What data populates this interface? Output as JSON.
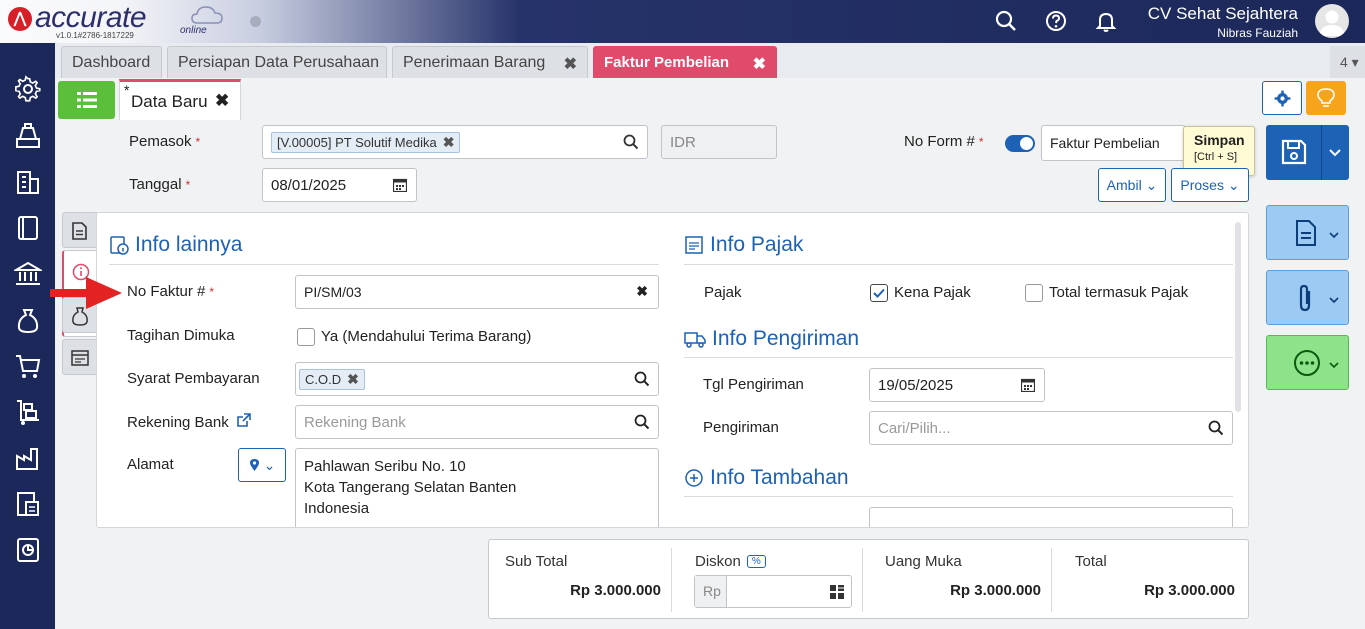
{
  "app": {
    "logo_text": "accurate",
    "logo_suffix": "online",
    "version": "v1.0.1#2786-1817229",
    "company_name": "CV Sehat Sejahtera",
    "user_name": "Nibras Fauziah"
  },
  "tabs": [
    {
      "label": "Dashboard"
    },
    {
      "label": "Persiapan Data Perusahaan"
    },
    {
      "label": "Penerimaan Barang",
      "close": "✖"
    },
    {
      "label": "Faktur Pembelian",
      "close": "✖"
    }
  ],
  "tab_count": "4",
  "subtab": {
    "star": "*",
    "label": "Data Baru",
    "close": "✖"
  },
  "header_form": {
    "pemasok_label": "Pemasok",
    "pemasok_value": "[V.00005] PT Solutif Medika",
    "currency": "IDR",
    "tanggal_label": "Tanggal",
    "tanggal_value": "08/01/2025",
    "no_form_label": "No Form #",
    "no_form_value": "Faktur Pembelian",
    "ambil_label": "Ambil",
    "proses_label": "Proses",
    "required_mark": "*"
  },
  "tooltip": {
    "title": "Simpan",
    "shortcut": "[Ctrl + S]"
  },
  "info_lainnya": {
    "title": "Info lainnya",
    "no_faktur_label": "No Faktur #",
    "no_faktur_value": "PI/SM/03",
    "tagihan_label": "Tagihan Dimuka",
    "tagihan_option": "Ya (Mendahului Terima Barang)",
    "syarat_label": "Syarat Pembayaran",
    "syarat_value": "C.O.D",
    "rekening_label": "Rekening Bank",
    "rekening_placeholder": "Rekening Bank",
    "alamat_label": "Alamat",
    "alamat_lines": [
      "Pahlawan Seribu No. 10",
      "Kota Tangerang Selatan Banten",
      "Indonesia"
    ]
  },
  "info_pajak": {
    "title": "Info Pajak",
    "pajak_label": "Pajak",
    "kena_pajak": "Kena Pajak",
    "kena_pajak_checked": true,
    "termasuk_pajak": "Total termasuk Pajak",
    "termasuk_pajak_checked": false
  },
  "info_pengiriman": {
    "title": "Info Pengiriman",
    "tgl_label": "Tgl Pengiriman",
    "tgl_value": "19/05/2025",
    "pengiriman_label": "Pengiriman",
    "pengiriman_placeholder": "Cari/Pilih..."
  },
  "info_tambahan": {
    "title": "Info Tambahan"
  },
  "summary": {
    "subtotal_label": "Sub Total",
    "subtotal_value": "Rp 3.000.000",
    "diskon_label": "Diskon",
    "diskon_pct": "%",
    "diskon_prefix": "Rp",
    "uang_muka_label": "Uang Muka",
    "uang_muka_value": "Rp 3.000.000",
    "total_label": "Total",
    "total_value": "Rp 3.000.000"
  },
  "colors": {
    "accent": "#1d62b4",
    "tab_active": "#e04a6b",
    "sidebar": "#1c2859",
    "list_btn": "#5cbf3c",
    "bulb_btn": "#f6a41b"
  }
}
